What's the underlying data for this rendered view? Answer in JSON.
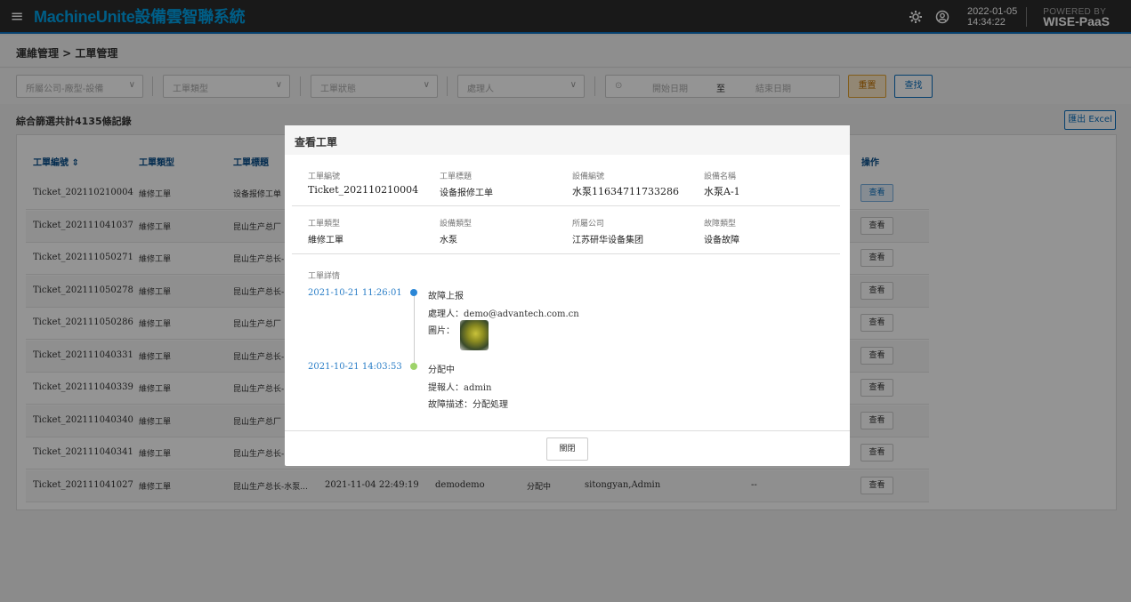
{
  "app": {
    "title": "MachineUnite設備雲智聯系統",
    "date": "2022-01-05",
    "time": "14:34:22",
    "powered_line1": "POWERED BY",
    "powered_line2": "WISE-PaaS"
  },
  "breadcrumb": "運維管理 > 工單管理",
  "filters": {
    "company_placeholder": "所屬公司-廠型-設備",
    "type_placeholder": "工單類型",
    "status_placeholder": "工單狀態",
    "handler_placeholder": "處理人",
    "start_date_placeholder": "開始日期",
    "date_to": "至",
    "end_date_placeholder": "結束日期",
    "reset_label": "重置",
    "search_label": "查找"
  },
  "record_count": "綜合篩選共計4135條記錄",
  "export_label": "匯出 Excel",
  "table": {
    "headers": {
      "ticket_no": "工單編號 ⇕",
      "type": "工單類型",
      "title": "工單標題",
      "action": "操作"
    },
    "view_label": "查看",
    "rows": [
      {
        "ticket": "Ticket_202110210004",
        "type": "維修工單",
        "title": "设备报修工单"
      },
      {
        "ticket": "Ticket_202111041037",
        "type": "維修工單",
        "title": "昆山生产总厂"
      },
      {
        "ticket": "Ticket_202111050271",
        "type": "維修工單",
        "title": "昆山生产总长-"
      },
      {
        "ticket": "Ticket_202111050278",
        "type": "維修工單",
        "title": "昆山生产总长-"
      },
      {
        "ticket": "Ticket_202111050286",
        "type": "維修工單",
        "title": "昆山生产总厂"
      },
      {
        "ticket": "Ticket_202111040331",
        "type": "維修工單",
        "title": "昆山生产总长-"
      },
      {
        "ticket": "Ticket_202111040339",
        "type": "維修工單",
        "title": "昆山生产总长-"
      },
      {
        "ticket": "Ticket_202111040340",
        "type": "維修工單",
        "title": "昆山生产总厂"
      },
      {
        "ticket": "Ticket_202111040341",
        "type": "維修工單",
        "title": "昆山生产总长-"
      },
      {
        "ticket": "Ticket_202111041027",
        "type": "維修工單",
        "title": "昆山生产总长-水泵...",
        "created": "2021-11-04 22:49:19",
        "creator": "demodemo",
        "status": "分配中",
        "handler": "sitongyan,Admin",
        "extra": "--"
      }
    ]
  },
  "modal": {
    "title": "查看工單",
    "fields": {
      "ticket_no_label": "工單編號",
      "ticket_no": "Ticket_202110210004",
      "ticket_title_label": "工單標題",
      "ticket_title": "设备报修工单",
      "device_no_label": "設備編號",
      "device_no": "水泵11634711733286",
      "device_name_label": "設備名稱",
      "device_name": "水泵A-1",
      "ticket_type_label": "工單類型",
      "ticket_type": "維修工單",
      "device_type_label": "設備類型",
      "device_type": "水泵",
      "company_label": "所屬公司",
      "company": "江苏研华设备集团",
      "fault_type_label": "故障類型",
      "fault_type": "设备故障"
    },
    "details_label": "工單詳情",
    "timeline": [
      {
        "time": "2021-10-21 11:26:01",
        "status": "故障上报",
        "line2_label": "處理人：",
        "line2_value": "demo@advantech.com.cn",
        "line3_label": "圖片："
      },
      {
        "time": "2021-10-21 14:03:53",
        "status": "分配中",
        "line2_label": "提報人：",
        "line2_value": "admin",
        "line3_label": "故障描述：",
        "line3_value": "分配処理"
      }
    ],
    "close_label": "關閉"
  },
  "colors": {
    "accent": "#0a6ebd",
    "dot_blue": "#2a86d6",
    "dot_green": "#9ed36a"
  }
}
